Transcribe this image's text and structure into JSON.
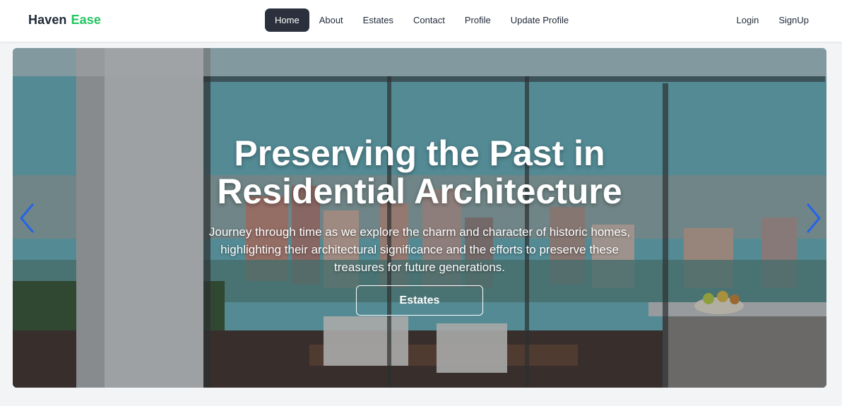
{
  "brand": {
    "name": "Haven",
    "accent": "Ease",
    "accent_color": "#22c55e"
  },
  "nav": {
    "items": [
      {
        "label": "Home",
        "active": true
      },
      {
        "label": "About"
      },
      {
        "label": "Estates"
      },
      {
        "label": "Contact"
      },
      {
        "label": "Profile"
      },
      {
        "label": "Update Profile"
      }
    ],
    "auth": [
      {
        "label": "Login"
      },
      {
        "label": "SignUp"
      }
    ]
  },
  "hero": {
    "title_line1": "Preserving the Past in",
    "title_line2": "Residential Architecture",
    "description": "Journey through time as we explore the charm and character of historic homes, highlighting their architectural significance and the efforts to preserve these treasures for future generations.",
    "button_label": "Estates",
    "arrow_color": "#2563eb",
    "prev_icon": "chevron-left-icon",
    "next_icon": "chevron-right-icon"
  }
}
